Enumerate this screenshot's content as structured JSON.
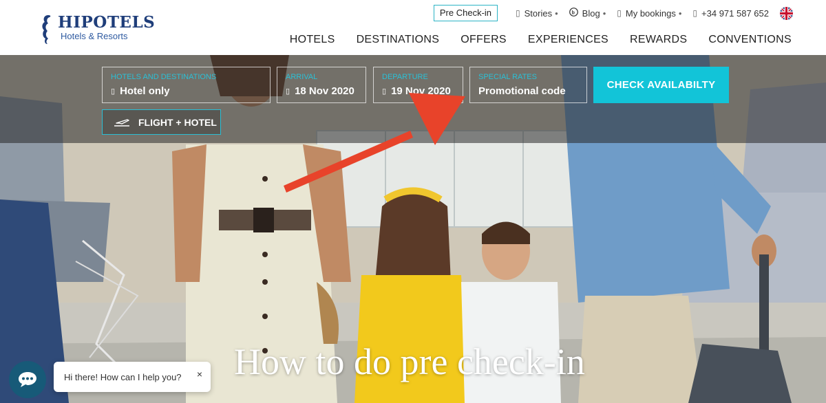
{
  "brand": {
    "name": "HIPOTELS",
    "tagline": "Hotels & Resorts"
  },
  "top_links": {
    "precheckin": "Pre Check-in",
    "stories": "Stories",
    "blog": "Blog",
    "bookings": "My bookings",
    "phone": "+34 971 587 652",
    "dot": "•"
  },
  "nav": [
    "HOTELS",
    "DESTINATIONS",
    "OFFERS",
    "EXPERIENCES",
    "REWARDS",
    "CONVENTIONS"
  ],
  "booking": {
    "hotels": {
      "label": "HOTELS AND DESTINATIONS",
      "value": "Hotel only"
    },
    "arrival": {
      "label": "ARRIVAL",
      "value": "18 Nov 2020"
    },
    "departure": {
      "label": "DEPARTURE",
      "value": "19 Nov 2020"
    },
    "special": {
      "label": "SPECIAL RATES",
      "value": "Promotional code"
    },
    "check_button": "CHECK AVAILABILTY",
    "flight_hotel": "FLIGHT + HOTEL"
  },
  "hero": {
    "title": "How to do pre check-in"
  },
  "chat": {
    "message": "Hi there! How can I help you?",
    "close": "×"
  },
  "icons": {
    "logo": "seahorse-icon",
    "flag": "uk-flag-icon",
    "chat": "chat-bubble-icon",
    "flight": "airplane-icon"
  },
  "colors": {
    "accent": "#12c4d8",
    "brand_navy": "#1f3e7a",
    "chat": "#175a78",
    "arrow": "#e8432a"
  }
}
